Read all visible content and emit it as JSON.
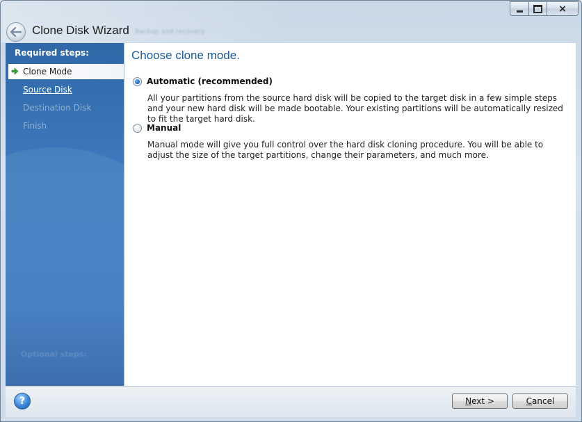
{
  "window": {
    "title": "Clone Disk Wizard",
    "subtitle_blurred": "Backup and recovery",
    "controls": {
      "minimize": "minimize",
      "maximize": "maximize",
      "close": "×"
    }
  },
  "sidebar": {
    "heading": "Required steps:",
    "steps": [
      {
        "label": "Clone Mode",
        "state": "active"
      },
      {
        "label": "Source Disk",
        "state": "link"
      },
      {
        "label": "Destination Disk",
        "state": "disabled"
      },
      {
        "label": "Finish",
        "state": "disabled"
      }
    ],
    "optional_heading": "Optional steps:"
  },
  "main": {
    "heading": "Choose clone mode.",
    "options": [
      {
        "label": "Automatic (recommended)",
        "selected": true,
        "description": "All your partitions from the source hard disk will be copied to the target disk in a few simple steps and your new hard disk will be made bootable. Your existing partitions will be automatically resized to fit the target hard disk."
      },
      {
        "label": "Manual",
        "selected": false,
        "description": "Manual mode will give you full control over the hard disk cloning procedure. You will be able to adjust the size of the target partitions, change their parameters, and much more."
      }
    ]
  },
  "footer": {
    "help_glyph": "?",
    "next_button": {
      "mnemonic": "N",
      "rest": "ext >"
    },
    "cancel_button": {
      "mnemonic": "C",
      "rest": "ancel"
    }
  },
  "colors": {
    "sidebar_blue": "#3d7ac0",
    "heading_blue": "#1e5a98",
    "radio_selected": "#1f73c7"
  }
}
